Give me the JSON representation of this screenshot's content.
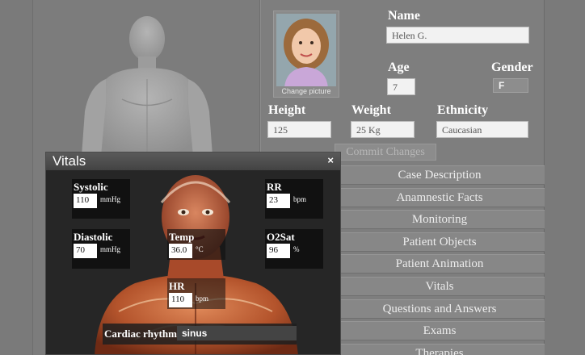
{
  "profile": {
    "change_picture": "Change picture",
    "name_label": "Name",
    "name_value": "Helen G.",
    "age_label": "Age",
    "age_value": "7",
    "gender_label": "Gender",
    "gender_value": "F",
    "height_label": "Height",
    "height_value": "125",
    "weight_label": "Weight",
    "weight_value": "25 Kg",
    "ethnicity_label": "Ethnicity",
    "ethnicity_value": "Caucasian",
    "commit_label": "Commit Changes"
  },
  "menu": {
    "items": [
      "Case Description",
      "Anamnestic Facts",
      "Monitoring",
      "Patient Objects",
      "Patient Animation",
      "Vitals",
      "Questions and Answers",
      "Exams",
      "Therapies"
    ]
  },
  "vitals": {
    "title": "Vitals",
    "close": "×",
    "systolic": {
      "label": "Systolic",
      "value": "110",
      "unit": "mmHg"
    },
    "diastolic": {
      "label": "Diastolic",
      "value": "70",
      "unit": "mmHg"
    },
    "temp": {
      "label": "Temp",
      "value": "36.0",
      "unit": "°C"
    },
    "hr": {
      "label": "HR",
      "value": "110",
      "unit": "bpm"
    },
    "rr": {
      "label": "RR",
      "value": "23",
      "unit": "bpm"
    },
    "o2sat": {
      "label": "O2Sat",
      "value": "96",
      "unit": "%"
    },
    "cardiac_label": "Cardiac rhythm:",
    "cardiac_value": "sinus"
  }
}
